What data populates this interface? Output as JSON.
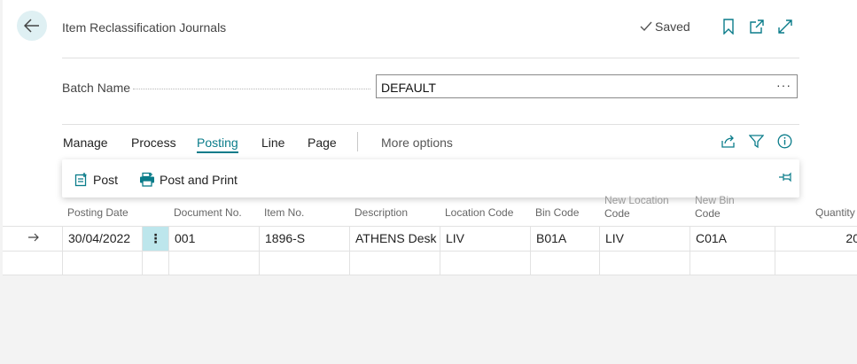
{
  "header": {
    "title": "Item Reclassification Journals",
    "saved_label": "Saved"
  },
  "batch": {
    "label": "Batch Name",
    "value": "DEFAULT",
    "more": "···"
  },
  "menu": {
    "items": [
      "Manage",
      "Process",
      "Posting",
      "Line",
      "Page"
    ],
    "active": "Posting",
    "more_options": "More options"
  },
  "actions": {
    "post": "Post",
    "post_and_print": "Post and Print"
  },
  "table": {
    "headers": {
      "posting_date": "Posting Date",
      "document_no": "Document No.",
      "item_no": "Item No.",
      "description": "Description",
      "location_code": "Location Code",
      "bin_code": "Bin Code",
      "new_location_code_1": "New Location",
      "new_location_code_2": "Code",
      "new_bin_code_1": "New Bin",
      "new_bin_code_2": "Code",
      "quantity": "Quantity"
    },
    "rows": [
      {
        "posting_date": "30/04/2022",
        "document_no": "001",
        "item_no": "1896-S",
        "description": "ATHENS Desk",
        "location_code": "LIV",
        "bin_code": "B01A",
        "new_location_code": "LIV",
        "new_bin_code": "C01A",
        "quantity": "20"
      }
    ]
  },
  "colors": {
    "accent": "#0a7c8a",
    "selected_cell": "#bde6ec",
    "back_button": "#dff0f3"
  }
}
